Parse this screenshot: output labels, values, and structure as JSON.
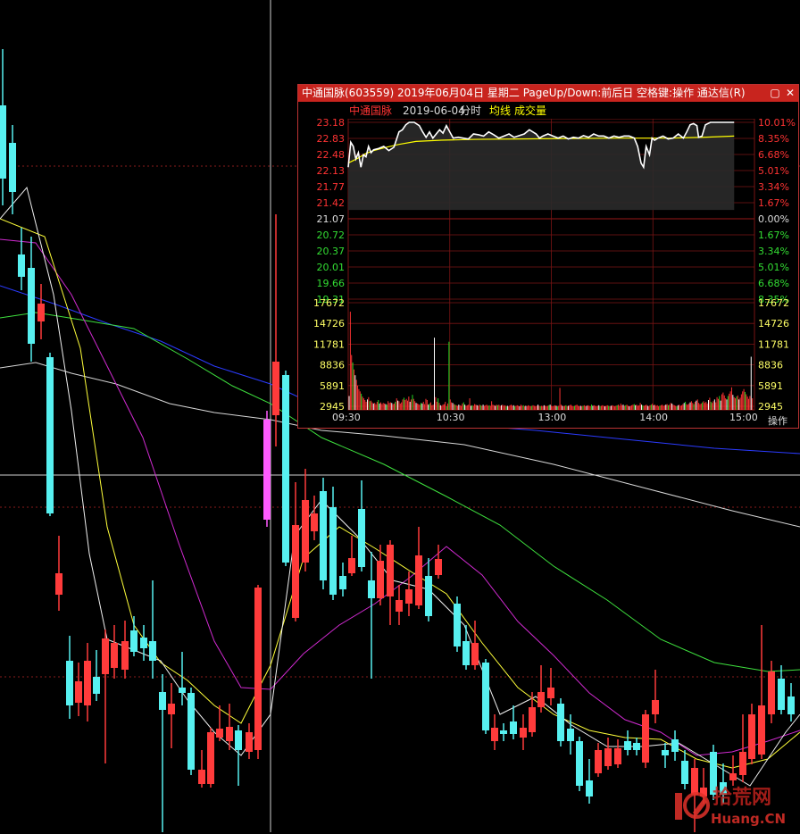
{
  "popup": {
    "title": "中通国脉(603559) 2019年06月04日 星期二 PageUp/Down:前后日 空格键:操作 通达信(R)",
    "restore_icon": "▢",
    "close_icon": "✕",
    "stock_name": "中通国脉",
    "date": "2019-06-04",
    "chart_kind": "分时",
    "avg_label": "均线",
    "volume_label": "成交量",
    "ops_label": "操作",
    "colors": {
      "titlebar": "#c8241e",
      "price_line": "#ffffff",
      "avg_line": "#ffff00",
      "up": "#ff3333",
      "down": "#00dd00",
      "grid": "#7a1414"
    }
  },
  "chart_data": [
    {
      "type": "line",
      "title": "中通国脉 2019-06-04 分时",
      "x_ticks": [
        "09:30",
        "10:30",
        "13:00",
        "14:00",
        "15:00"
      ],
      "price_ticks": [
        "23.18",
        "22.83",
        "22.48",
        "22.13",
        "21.77",
        "21.42",
        "21.07",
        "20.72",
        "20.37",
        "20.01",
        "19.66",
        "19.31"
      ],
      "pct_ticks": [
        "10.01%",
        "8.35%",
        "6.68%",
        "5.01%",
        "3.34%",
        "1.67%",
        "0.00%",
        "1.67%",
        "3.34%",
        "5.01%",
        "6.68%",
        "8.35%"
      ],
      "volume_ticks": [
        "17672",
        "14726",
        "11781",
        "8836",
        "5891",
        "2945"
      ],
      "prev_close": 21.07,
      "ylim": [
        19.31,
        23.18
      ],
      "series": [
        {
          "values": [
            [
              0,
              22.1
            ],
            [
              3,
              22.7
            ],
            [
              6,
              22.6
            ],
            [
              9,
              22.3
            ],
            [
              12,
              22.45
            ],
            [
              15,
              22.1
            ],
            [
              18,
              22.4
            ],
            [
              21,
              22.35
            ],
            [
              24,
              22.6
            ],
            [
              27,
              22.45
            ],
            [
              30,
              22.52
            ],
            [
              36,
              22.55
            ],
            [
              42,
              22.6
            ],
            [
              48,
              22.5
            ],
            [
              54,
              22.58
            ],
            [
              60,
              22.95
            ],
            [
              64,
              23.0
            ],
            [
              68,
              23.12
            ],
            [
              72,
              23.18
            ],
            [
              78,
              23.18
            ],
            [
              84,
              23.1
            ],
            [
              88,
              22.95
            ],
            [
              92,
              22.82
            ],
            [
              96,
              22.95
            ],
            [
              100,
              22.8
            ],
            [
              104,
              22.9
            ],
            [
              108,
              23.0
            ],
            [
              112,
              22.92
            ],
            [
              116,
              23.1
            ],
            [
              120,
              22.95
            ],
            [
              124,
              22.8
            ],
            [
              130,
              22.82
            ],
            [
              136,
              22.8
            ],
            [
              142,
              22.78
            ],
            [
              148,
              22.9
            ],
            [
              154,
              22.88
            ],
            [
              160,
              22.85
            ],
            [
              166,
              22.95
            ],
            [
              172,
              22.88
            ],
            [
              178,
              22.8
            ],
            [
              184,
              22.85
            ],
            [
              190,
              22.9
            ],
            [
              196,
              22.82
            ],
            [
              202,
              22.86
            ],
            [
              208,
              22.9
            ],
            [
              214,
              23.0
            ],
            [
              218,
              22.95
            ],
            [
              222,
              22.9
            ],
            [
              226,
              22.8
            ],
            [
              230,
              22.85
            ],
            [
              236,
              22.9
            ],
            [
              242,
              22.85
            ],
            [
              248,
              22.8
            ],
            [
              254,
              22.85
            ],
            [
              260,
              22.78
            ],
            [
              266,
              22.82
            ],
            [
              272,
              22.8
            ],
            [
              278,
              22.86
            ],
            [
              284,
              22.82
            ],
            [
              290,
              22.9
            ],
            [
              296,
              22.85
            ],
            [
              302,
              22.85
            ],
            [
              308,
              22.8
            ],
            [
              314,
              22.85
            ],
            [
              320,
              22.82
            ],
            [
              326,
              22.85
            ],
            [
              332,
              22.85
            ],
            [
              338,
              22.8
            ],
            [
              342,
              22.6
            ],
            [
              346,
              22.2
            ],
            [
              349,
              22.1
            ],
            [
              352,
              22.6
            ],
            [
              356,
              22.4
            ],
            [
              359,
              22.8
            ],
            [
              362,
              22.75
            ],
            [
              366,
              22.8
            ],
            [
              372,
              22.85
            ],
            [
              378,
              22.78
            ],
            [
              384,
              22.8
            ],
            [
              390,
              22.9
            ],
            [
              396,
              22.8
            ],
            [
              400,
              22.95
            ],
            [
              404,
              23.12
            ],
            [
              408,
              23.15
            ],
            [
              412,
              23.1
            ],
            [
              414,
              22.82
            ],
            [
              418,
              22.85
            ],
            [
              422,
              23.12
            ],
            [
              428,
              23.18
            ],
            [
              434,
              23.18
            ],
            [
              440,
              23.18
            ],
            [
              446,
              23.18
            ],
            [
              452,
              23.18
            ],
            [
              456,
              23.18
            ]
          ]
        },
        {
          "values": [
            [
              0,
              22.2
            ],
            [
              10,
              22.3
            ],
            [
              20,
              22.42
            ],
            [
              30,
              22.5
            ],
            [
              45,
              22.58
            ],
            [
              60,
              22.65
            ],
            [
              80,
              22.72
            ],
            [
              110,
              22.75
            ],
            [
              150,
              22.77
            ],
            [
              200,
              22.78
            ],
            [
              260,
              22.79
            ],
            [
              320,
              22.8
            ],
            [
              380,
              22.8
            ],
            [
              420,
              22.82
            ],
            [
              456,
              22.85
            ]
          ]
        }
      ],
      "volume": [
        2400,
        17000,
        9500,
        8200,
        7000,
        6000,
        5200,
        4200,
        3600,
        3200,
        2800,
        2300,
        2000,
        1700,
        1400,
        1800,
        2200,
        1500,
        1600,
        1300,
        1100,
        1200,
        1000,
        1400,
        1700,
        1100,
        1300,
        1000,
        1200,
        1100,
        1000,
        900,
        1500,
        1200,
        1300,
        1200,
        1000,
        1100,
        1400,
        2000,
        1600,
        1500,
        1100,
        1300,
        1800,
        2100,
        1700,
        1900,
        1600,
        2300,
        1400,
        1800,
        2600,
        1900,
        1500,
        1200,
        1100,
        1000,
        900,
        1200,
        1100,
        1400,
        1000,
        1900,
        1700,
        900,
        1100,
        1300,
        800,
        900,
        12500,
        2200,
        1400,
        2000,
        1200,
        800,
        700,
        900,
        1000,
        1400,
        600,
        1100,
        11800,
        1800,
        1300,
        1200,
        1000,
        900,
        800,
        700,
        900,
        800,
        700,
        1100,
        1300,
        900,
        700,
        800,
        900,
        2000,
        700,
        800,
        700,
        1000,
        900,
        800,
        700,
        900,
        800,
        700,
        900,
        700,
        800,
        900,
        700,
        800,
        700,
        1500,
        900,
        800,
        700,
        900,
        800,
        900,
        700,
        800,
        900,
        700,
        800,
        600,
        700,
        600,
        800,
        900,
        700,
        800,
        600,
        700,
        800,
        700,
        600,
        900,
        700,
        800,
        600,
        700,
        600,
        800,
        700,
        600,
        700,
        800,
        700,
        600,
        700,
        900,
        700,
        600,
        700,
        600,
        800,
        700,
        600,
        700,
        800,
        900,
        700,
        600,
        700,
        800,
        700,
        600,
        700,
        3800,
        900,
        700,
        600,
        700,
        800,
        600,
        700,
        800,
        900,
        700,
        600,
        700,
        800,
        900,
        700,
        600,
        700,
        600,
        700,
        800,
        600,
        700,
        800,
        700,
        600,
        900,
        700,
        800,
        700,
        600,
        700,
        800,
        600,
        700,
        800,
        700,
        600,
        700,
        800,
        700,
        600,
        700,
        800,
        700,
        600,
        700,
        800,
        900,
        700,
        1100,
        800,
        900,
        700,
        800,
        900,
        700,
        600,
        700,
        800,
        900,
        1000,
        800,
        900,
        700,
        800,
        1200,
        900,
        800,
        700,
        800,
        900,
        700,
        600,
        800,
        900,
        1100,
        800,
        900,
        700,
        800,
        600,
        700,
        800,
        900,
        700,
        800,
        900,
        1000,
        800,
        900,
        1200,
        1100,
        900,
        800,
        700,
        600,
        800,
        900,
        700,
        800,
        1000,
        1200,
        1400,
        1000,
        900,
        1100,
        1300,
        1500,
        1200,
        1000,
        1400,
        1600,
        1800,
        1200,
        1000,
        1100,
        1300,
        1500,
        1200,
        1400,
        1100,
        1700,
        2100,
        1400,
        1200,
        1500,
        1800,
        1300,
        2200,
        1900,
        2400,
        1600,
        2700,
        3000,
        2500,
        2000,
        1800,
        2400,
        2800,
        3200,
        3900,
        2600,
        2200,
        2000,
        2300,
        2500,
        1800,
        2100,
        2700,
        3200,
        3600,
        3100,
        2700,
        2300,
        1900,
        2400,
        9200,
        2000
      ]
    }
  ]
}
